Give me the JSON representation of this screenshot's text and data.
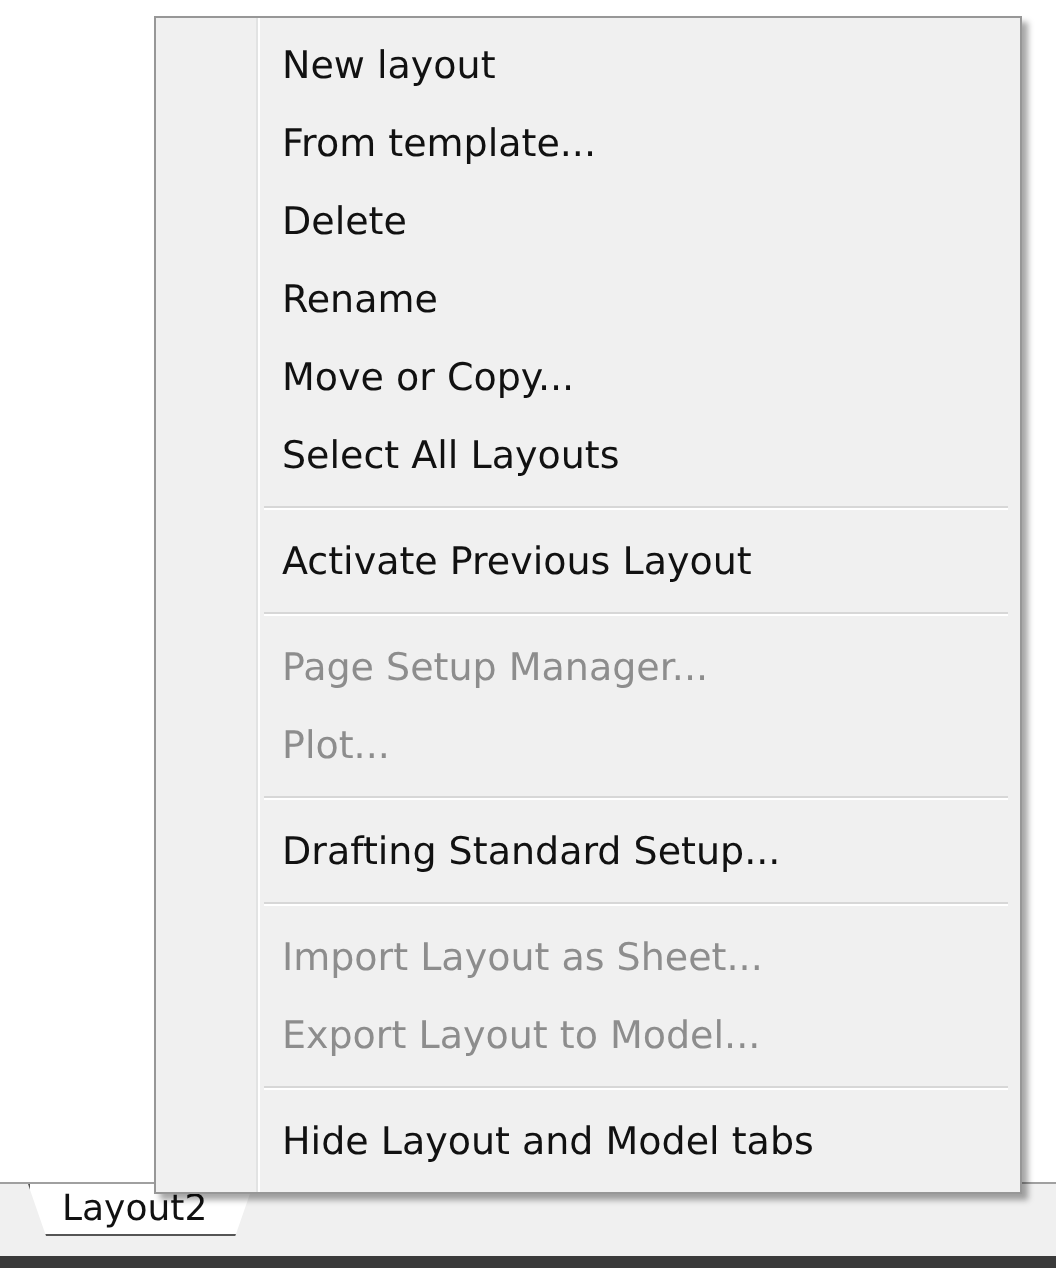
{
  "context_menu": {
    "entries": [
      {
        "kind": "item",
        "label": "New layout",
        "disabled": false
      },
      {
        "kind": "item",
        "label": "From template...",
        "disabled": false
      },
      {
        "kind": "item",
        "label": "Delete",
        "disabled": false
      },
      {
        "kind": "item",
        "label": "Rename",
        "disabled": false
      },
      {
        "kind": "item",
        "label": "Move or Copy...",
        "disabled": false
      },
      {
        "kind": "item",
        "label": "Select All Layouts",
        "disabled": false
      },
      {
        "kind": "separator"
      },
      {
        "kind": "item",
        "label": "Activate Previous Layout",
        "disabled": false
      },
      {
        "kind": "separator"
      },
      {
        "kind": "item",
        "label": "Page Setup Manager...",
        "disabled": true
      },
      {
        "kind": "item",
        "label": "Plot...",
        "disabled": true
      },
      {
        "kind": "separator"
      },
      {
        "kind": "item",
        "label": "Drafting Standard Setup...",
        "disabled": false
      },
      {
        "kind": "separator"
      },
      {
        "kind": "item",
        "label": "Import Layout as Sheet...",
        "disabled": true
      },
      {
        "kind": "item",
        "label": "Export Layout to Model...",
        "disabled": true
      },
      {
        "kind": "separator"
      },
      {
        "kind": "item",
        "label": "Hide Layout and Model tabs",
        "disabled": false
      }
    ]
  },
  "layout_tabs": [
    {
      "label": "Layout2"
    }
  ]
}
